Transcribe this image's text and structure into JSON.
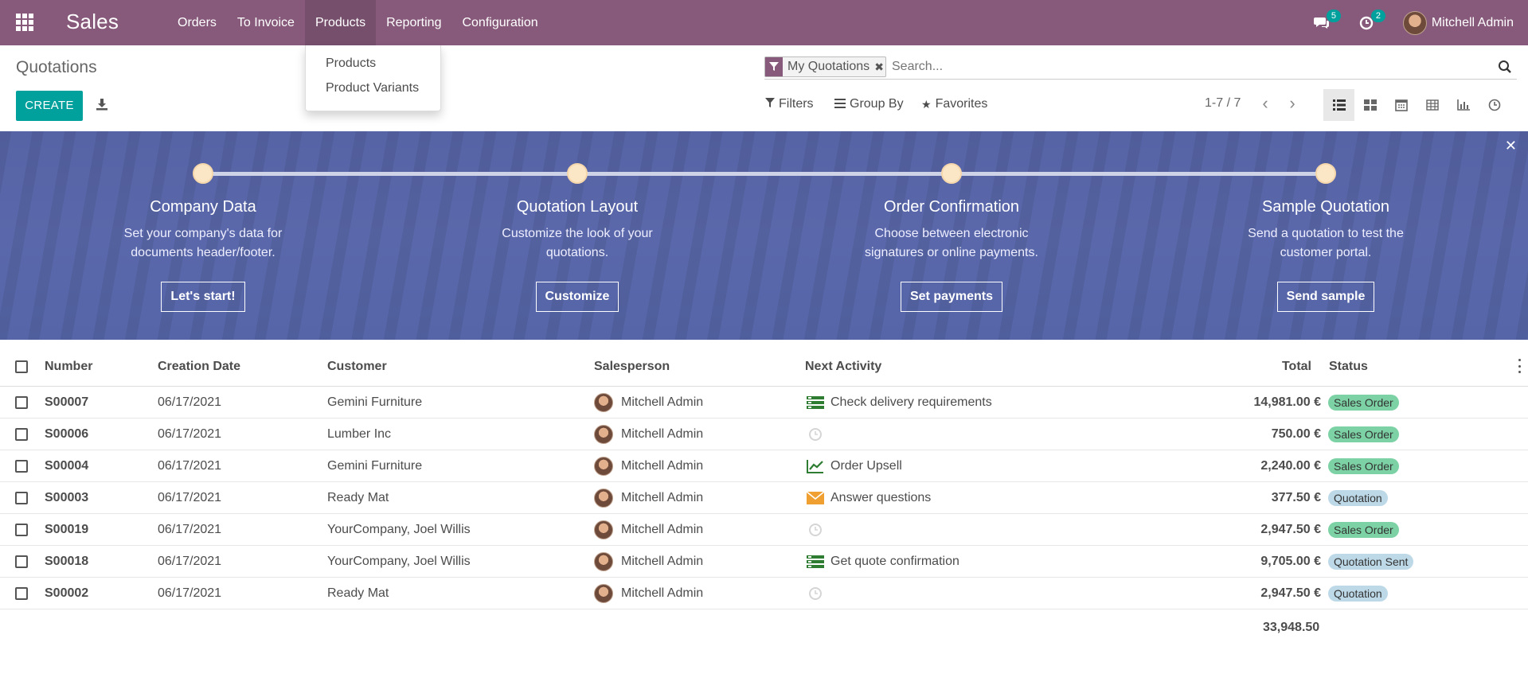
{
  "navbar": {
    "brand": "Sales",
    "menu": [
      "Orders",
      "To Invoice",
      "Products",
      "Reporting",
      "Configuration"
    ],
    "active_menu": "Products",
    "messages_count": "5",
    "activities_count": "2",
    "user_name": "Mitchell Admin",
    "bg_color": "#875a7b"
  },
  "dropdown": {
    "items": [
      "Products",
      "Product Variants"
    ]
  },
  "control": {
    "breadcrumb": "Quotations",
    "create_label": "CREATE",
    "facet_label": "My Quotations",
    "search_placeholder": "Search...",
    "filters_label": "Filters",
    "groupby_label": "Group By",
    "favorites_label": "Favorites",
    "pager": "1-7 / 7",
    "views": [
      "list-view-icon",
      "kanban-view-icon",
      "calendar-view-icon",
      "pivot-view-icon",
      "graph-view-icon",
      "activity-view-icon"
    ],
    "active_view": "list-view-icon"
  },
  "banner": {
    "steps": [
      {
        "title": "Company Data",
        "desc1": "Set your company's data for",
        "desc2": "documents header/footer.",
        "button": "Let's start!"
      },
      {
        "title": "Quotation Layout",
        "desc1": "Customize the look of your",
        "desc2": "quotations.",
        "button": "Customize"
      },
      {
        "title": "Order Confirmation",
        "desc1": "Choose between electronic",
        "desc2": "signatures or online payments.",
        "button": "Set payments"
      },
      {
        "title": "Sample Quotation",
        "desc1": "Send a quotation to test the",
        "desc2": "customer portal.",
        "button": "Send sample"
      }
    ]
  },
  "table": {
    "headers": {
      "number": "Number",
      "date": "Creation Date",
      "customer": "Customer",
      "salesperson": "Salesperson",
      "activity": "Next Activity",
      "total": "Total",
      "status": "Status"
    },
    "rows": [
      {
        "number": "S00007",
        "date": "06/17/2021",
        "customer": "Gemini Furniture",
        "salesperson": "Mitchell Admin",
        "activity": "Check delivery requirements",
        "activity_icon": "todo-icon",
        "total": "14,981.00 €",
        "status": "Sales Order"
      },
      {
        "number": "S00006",
        "date": "06/17/2021",
        "customer": "Lumber Inc",
        "salesperson": "Mitchell Admin",
        "activity": "",
        "activity_icon": "clock-icon",
        "total": "750.00 €",
        "status": "Sales Order"
      },
      {
        "number": "S00004",
        "date": "06/17/2021",
        "customer": "Gemini Furniture",
        "salesperson": "Mitchell Admin",
        "activity": "Order Upsell",
        "activity_icon": "upsell-chart-icon",
        "total": "2,240.00 €",
        "status": "Sales Order"
      },
      {
        "number": "S00003",
        "date": "06/17/2021",
        "customer": "Ready Mat",
        "salesperson": "Mitchell Admin",
        "activity": "Answer questions",
        "activity_icon": "envelope-icon",
        "total": "377.50 €",
        "status": "Quotation"
      },
      {
        "number": "S00019",
        "date": "06/17/2021",
        "customer": "YourCompany, Joel Willis",
        "salesperson": "Mitchell Admin",
        "activity": "",
        "activity_icon": "clock-icon",
        "total": "2,947.50 €",
        "status": "Sales Order"
      },
      {
        "number": "S00018",
        "date": "06/17/2021",
        "customer": "YourCompany, Joel Willis",
        "salesperson": "Mitchell Admin",
        "activity": "Get quote confirmation",
        "activity_icon": "todo-icon",
        "total": "9,705.00 €",
        "status": "Quotation Sent"
      },
      {
        "number": "S00002",
        "date": "06/17/2021",
        "customer": "Ready Mat",
        "salesperson": "Mitchell Admin",
        "activity": "",
        "activity_icon": "clock-icon",
        "total": "2,947.50 €",
        "status": "Quotation"
      }
    ],
    "sum_total": "33,948.50"
  }
}
